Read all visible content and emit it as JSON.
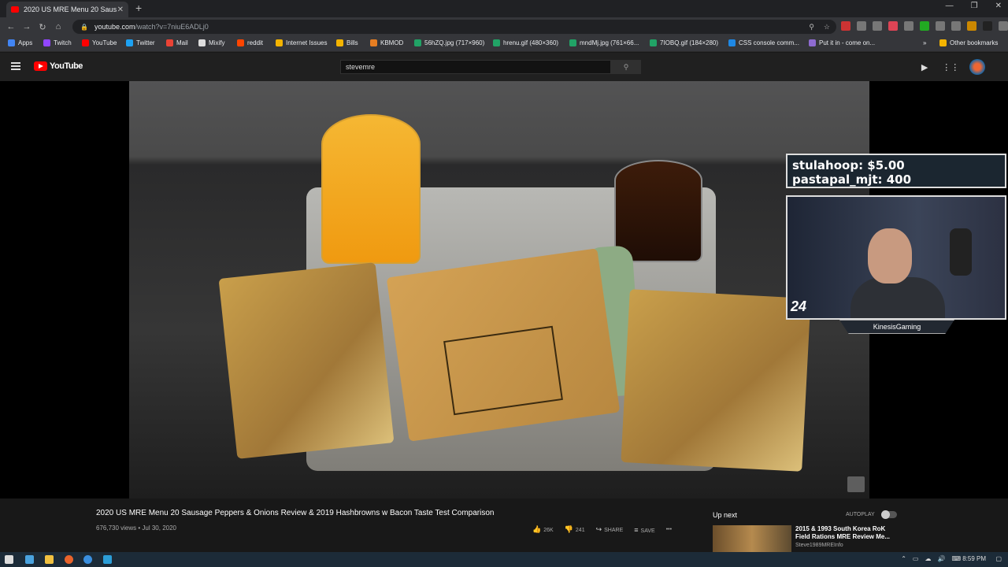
{
  "browser": {
    "tab_title": "2020 US MRE Menu 20 Saus...",
    "url_host": "youtube.com",
    "url_path": "/watch?v=7niuE6ADLj0",
    "bookmarks": [
      {
        "label": "Apps",
        "color": "#4285f4"
      },
      {
        "label": "Twitch",
        "color": "#9146ff"
      },
      {
        "label": "YouTube",
        "color": "#ff0000"
      },
      {
        "label": "Twitter",
        "color": "#1da1f2"
      },
      {
        "label": "Mail",
        "color": "#ea4335"
      },
      {
        "label": "Mixify",
        "color": "#dddddd"
      },
      {
        "label": "reddit",
        "color": "#ff4500"
      },
      {
        "label": "Internet Issues",
        "color": "#f4b400"
      },
      {
        "label": "Bills",
        "color": "#f4b400"
      },
      {
        "label": "KBMOD",
        "color": "#e67e22"
      },
      {
        "label": "56hZQ.jpg (717×960)",
        "color": "#21a366"
      },
      {
        "label": "hrenu.gif (480×360)",
        "color": "#21a366"
      },
      {
        "label": "mndMj.jpg (761×66...",
        "color": "#21a366"
      },
      {
        "label": "7IOBQ.gif (184×280)",
        "color": "#21a366"
      },
      {
        "label": "CSS console comm...",
        "color": "#1e88e5"
      },
      {
        "label": "Put it in - come on...",
        "color": "#8e6bd1"
      },
      {
        "label": "Other bookmarks",
        "color": "#f4b400"
      }
    ]
  },
  "youtube": {
    "logo": "YouTube",
    "search_value": "stevemre",
    "video_title": "2020 US MRE Menu 20 Sausage Peppers & Onions Review & 2019 Hashbrowns w Bacon Taste Test Comparison",
    "views": "676,730 views",
    "date": "Jul 30, 2020",
    "likes": "26K",
    "dislikes": "241",
    "share": "SHARE",
    "save": "SAVE",
    "up_next": "Up next",
    "autoplay": "AUTOPLAY",
    "next_title": "2015 & 1993 South Korea RoK Field Rations MRE Review Me...",
    "next_channel": "Steve1989MREInfo"
  },
  "overlay": {
    "donation_1": "stulahoop: $5.00",
    "donation_2": "pastapal_mjt: 400",
    "webcam_number": "24",
    "brand": "KinesisGaming"
  },
  "taskbar": {
    "time": "8:59 PM"
  }
}
